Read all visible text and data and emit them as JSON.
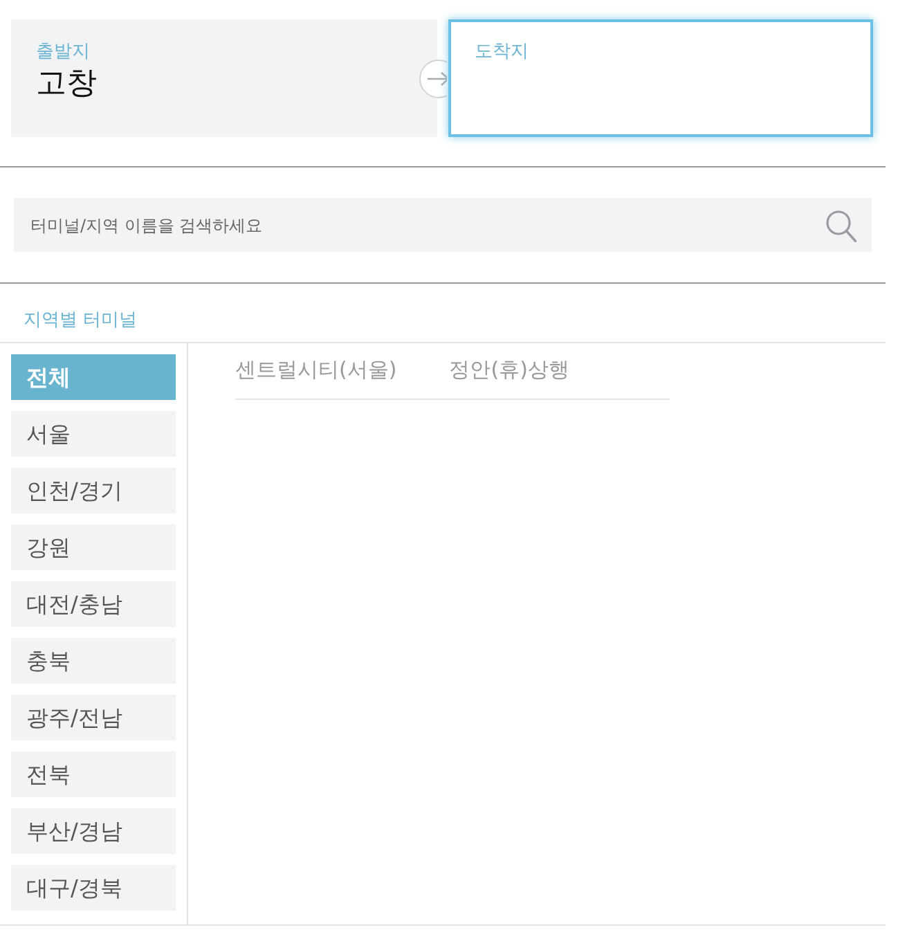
{
  "route": {
    "departure": {
      "label": "출발지",
      "value": "고창"
    },
    "arrival": {
      "label": "도착지",
      "focused": true
    }
  },
  "search": {
    "placeholder": "터미널/지역 이름을 검색하세요"
  },
  "section_title": "지역별 터미널",
  "regions": [
    {
      "label": "전체",
      "selected": true
    },
    {
      "label": "서울",
      "selected": false
    },
    {
      "label": "인천/경기",
      "selected": false
    },
    {
      "label": "강원",
      "selected": false
    },
    {
      "label": "대전/충남",
      "selected": false
    },
    {
      "label": "충북",
      "selected": false
    },
    {
      "label": "광주/전남",
      "selected": false
    },
    {
      "label": "전북",
      "selected": false
    },
    {
      "label": "부산/경남",
      "selected": false
    },
    {
      "label": "대구/경북",
      "selected": false
    }
  ],
  "terminals": [
    "센트럴시티(서울)",
    "정안(휴)상행"
  ]
}
